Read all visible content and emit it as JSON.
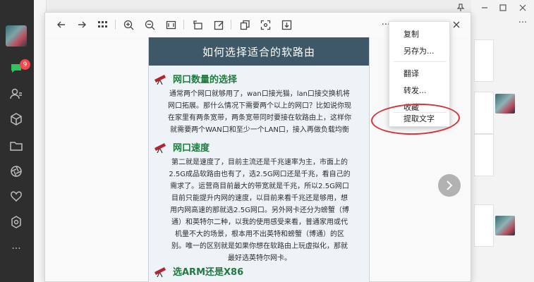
{
  "sidebar": {
    "badge_count": "9",
    "more_label": "···"
  },
  "window": {
    "more_label": "···"
  },
  "viewer": {
    "more_label": "···"
  },
  "article": {
    "title": "如何选择适合的软路由",
    "sections": [
      {
        "heading": "网口数量的选择",
        "lines": [
          "通常两个网口就够用了，wan口接光猫，lan口接交换机将",
          "网口拓展。那什么情况下需要两个以上的网口？比如说你现",
          "在家里有两条宽带，两条宽带同时要接在软路由上，这样你",
          "就需要两个WAN口和至少一个LAN口，接入再做负载均衡"
        ]
      },
      {
        "heading": "网口速度",
        "lines": [
          "第二就是速度了，目前主流还是千兆速率为主，市面上的",
          "2.5G成品软路由也有了，选2.5G网口还是千兆，看自己的",
          "需求了。运营商目前最大的带宽就是千兆，所以2.5G网口",
          "目前只能提升内网的速度，以目前来看千兆还是够用，想",
          "用内网高速的那就选2.5G网口。另外网卡还分为螃蟹（博",
          "通）和英特尔二种，以我的使用感受来看，普通家用或代",
          "机量不大的场景，根本用不出英特和螃蟹（博通）的区",
          "别。唯一的区别就是如果你想在软路由上玩虚拟化，那就",
          "最好选英特尔网卡。"
        ]
      },
      {
        "heading": "选ARM还是X86",
        "lines": []
      }
    ]
  },
  "context_menu": {
    "items": [
      "复制",
      "另存为...",
      "翻译",
      "转发...",
      "收藏",
      "提取文字"
    ]
  },
  "colors": {
    "highlight": "#d0353a",
    "section_heading": "#1f7a3e",
    "title_bar": "#3e5868"
  }
}
